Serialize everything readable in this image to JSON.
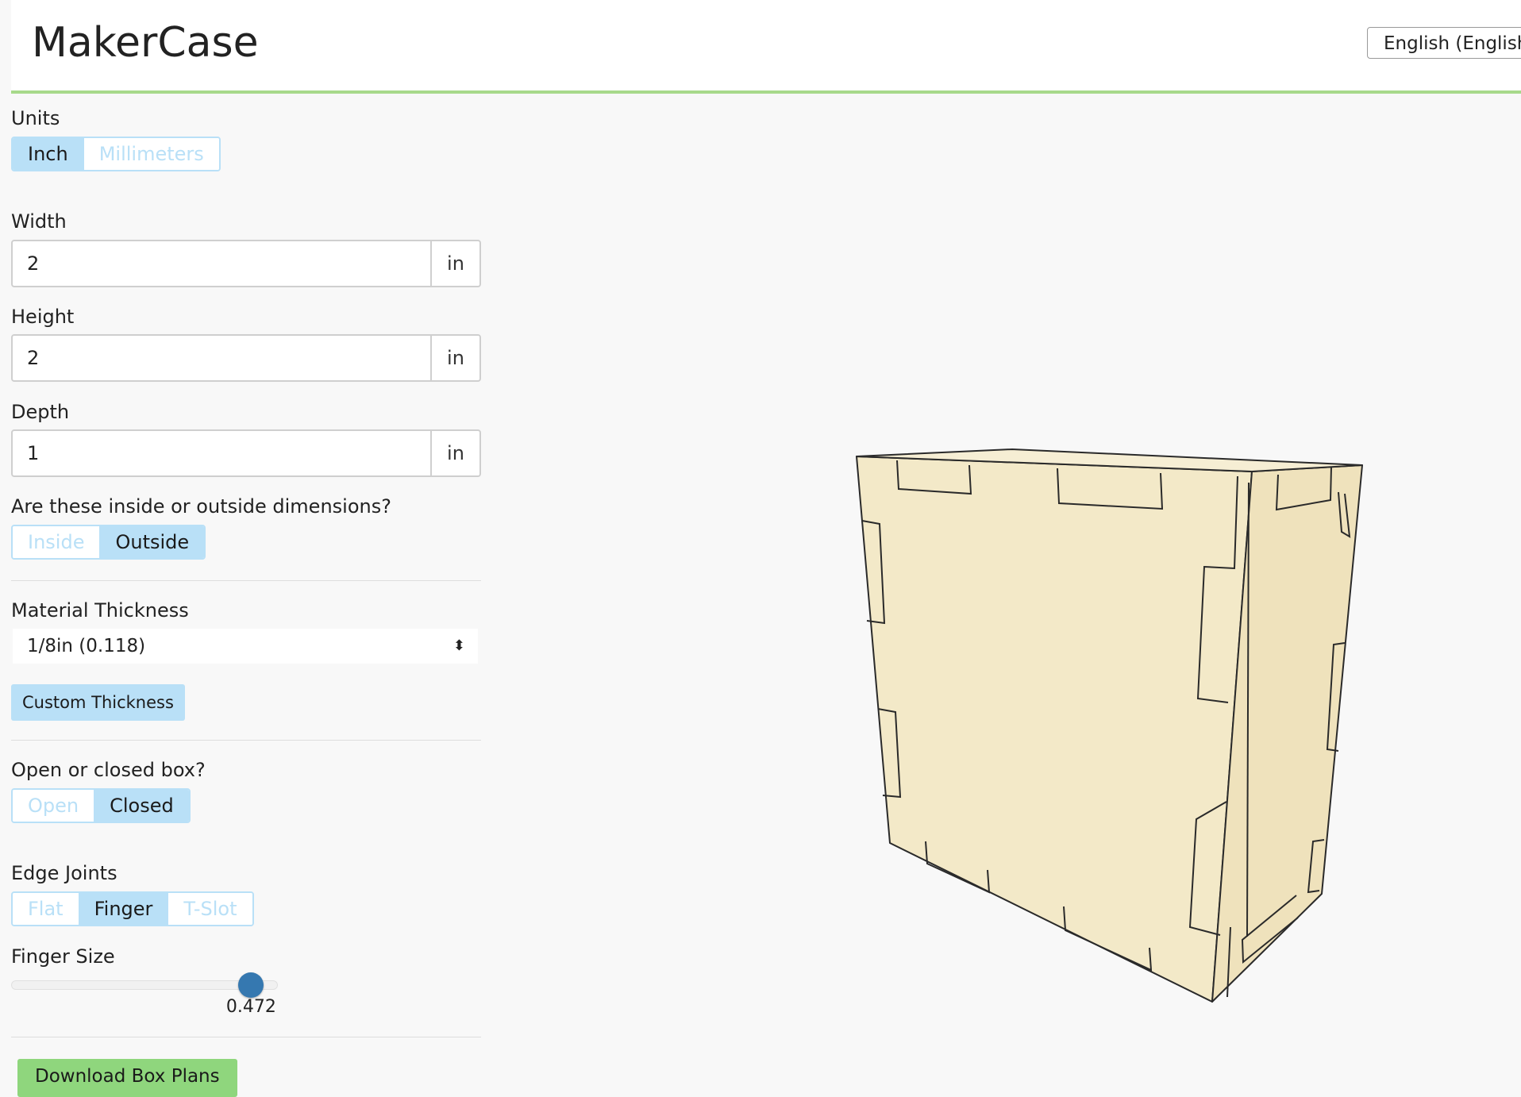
{
  "app": {
    "title": "MakerCase"
  },
  "language": {
    "selected": "English (English)"
  },
  "units": {
    "label": "Units",
    "options": [
      "Inch",
      "Millimeters"
    ],
    "selected": "Inch"
  },
  "dimensions": {
    "width": {
      "label": "Width",
      "value": "2",
      "unit": "in"
    },
    "height": {
      "label": "Height",
      "value": "2",
      "unit": "in"
    },
    "depth": {
      "label": "Depth",
      "value": "1",
      "unit": "in"
    }
  },
  "dimension_type": {
    "label": "Are these inside or outside dimensions?",
    "options": [
      "Inside",
      "Outside"
    ],
    "selected": "Outside"
  },
  "material": {
    "label": "Material Thickness",
    "selected": "1/8in (0.118)",
    "custom_button": "Custom Thickness"
  },
  "box_type": {
    "label": "Open or closed box?",
    "options": [
      "Open",
      "Closed"
    ],
    "selected": "Closed"
  },
  "edge_joints": {
    "label": "Edge Joints",
    "options": [
      "Flat",
      "Finger",
      "T-Slot"
    ],
    "selected": "Finger"
  },
  "finger_size": {
    "label": "Finger Size",
    "value": "0.472",
    "fraction": 0.9
  },
  "download": {
    "label": "Download Box Plans"
  },
  "colors": {
    "accent_blue": "#b9e0f7",
    "accent_green": "#8fd67d",
    "header_line": "#a7d98b",
    "slider": "#3578b0",
    "box_fill": "#f3e9c8"
  }
}
